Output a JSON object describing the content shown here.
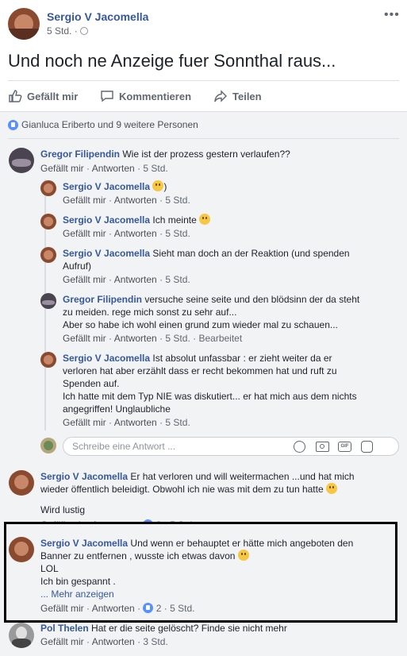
{
  "post": {
    "author": "Sergio V Jacomella",
    "time": "5 Std.",
    "text": "Und noch ne Anzeige fuer Sonnthal raus..."
  },
  "actions": {
    "like": "Gefällt mir",
    "comment": "Kommentieren",
    "share": "Teilen"
  },
  "likes_summary": "Gianluca Eriberto und 9 weitere Personen",
  "labels": {
    "like": "Gefällt mir",
    "reply": "Antworten",
    "edited": "Bearbeitet",
    "sep": "·",
    "show_more": "... Mehr anzeigen"
  },
  "comments": [
    {
      "author": "Gregor Filipendin",
      "text": "Wie ist der prozess gestern verlaufen??",
      "time": "5 Std.",
      "replies": [
        {
          "author": "Sergio V Jacomella",
          "text": ")",
          "time": "5 Std."
        },
        {
          "author": "Sergio V Jacomella",
          "text": "Ich meinte",
          "time": "5 Std."
        },
        {
          "author": "Sergio V Jacomella",
          "text1": "Sieht man doch an der Reaktion (und spenden",
          "text2": "Aufruf)",
          "time": "5 Std."
        },
        {
          "author": "Gregor Filipendin",
          "text1": "versuche seine seite und den blödsinn der da steht",
          "text2": "zu meiden. rege mich sonst zu sehr auf...",
          "text3": "Aber so habe ich wohl einen grund zum wieder mal zu schauen...",
          "time": "5 Std."
        },
        {
          "author": "Sergio V Jacomella",
          "text1": "Ist absolut unfassbar : er zieht weiter da er",
          "text2": "verloren hat aber erzählt dass er recht bekommen hat und ruft zu",
          "text3": "Spenden auf.",
          "text4": "Ich hatte mit dem Typ NIE was diskutiert... er hat mich aus dem nichts",
          "text5": "angegriffen! Unglaubliche",
          "time": "5 Std."
        }
      ],
      "reply_placeholder": "Schreibe eine Antwort ..."
    },
    {
      "author": "Sergio V Jacomella",
      "text1": "Er hat verloren und will weitermachen ...und hat mich",
      "text2": "wieder öffentlich beleidigt. Obwohl ich nie was mit dem zu tun hatte",
      "text3": "Wird lustig",
      "reactions": "3",
      "time": "5 Std."
    },
    {
      "author": "Sergio V Jacomella",
      "text1": "Und wenn er behauptet er hätte mich angeboten den",
      "text2": "Banner zu entfernen , wusste ich etwas davon",
      "text3": "LOL",
      "text4": "Ich bin gespannt .",
      "reactions": "2",
      "time": "5 Std."
    },
    {
      "author": "Pol Thelen",
      "text": "Hat er die seite gelöscht? Finde sie nicht mehr",
      "time": "3 Std."
    }
  ],
  "colors": {
    "link_blue": "#365899",
    "like_blue": "#5890ff",
    "highlight_border": "#000000"
  }
}
